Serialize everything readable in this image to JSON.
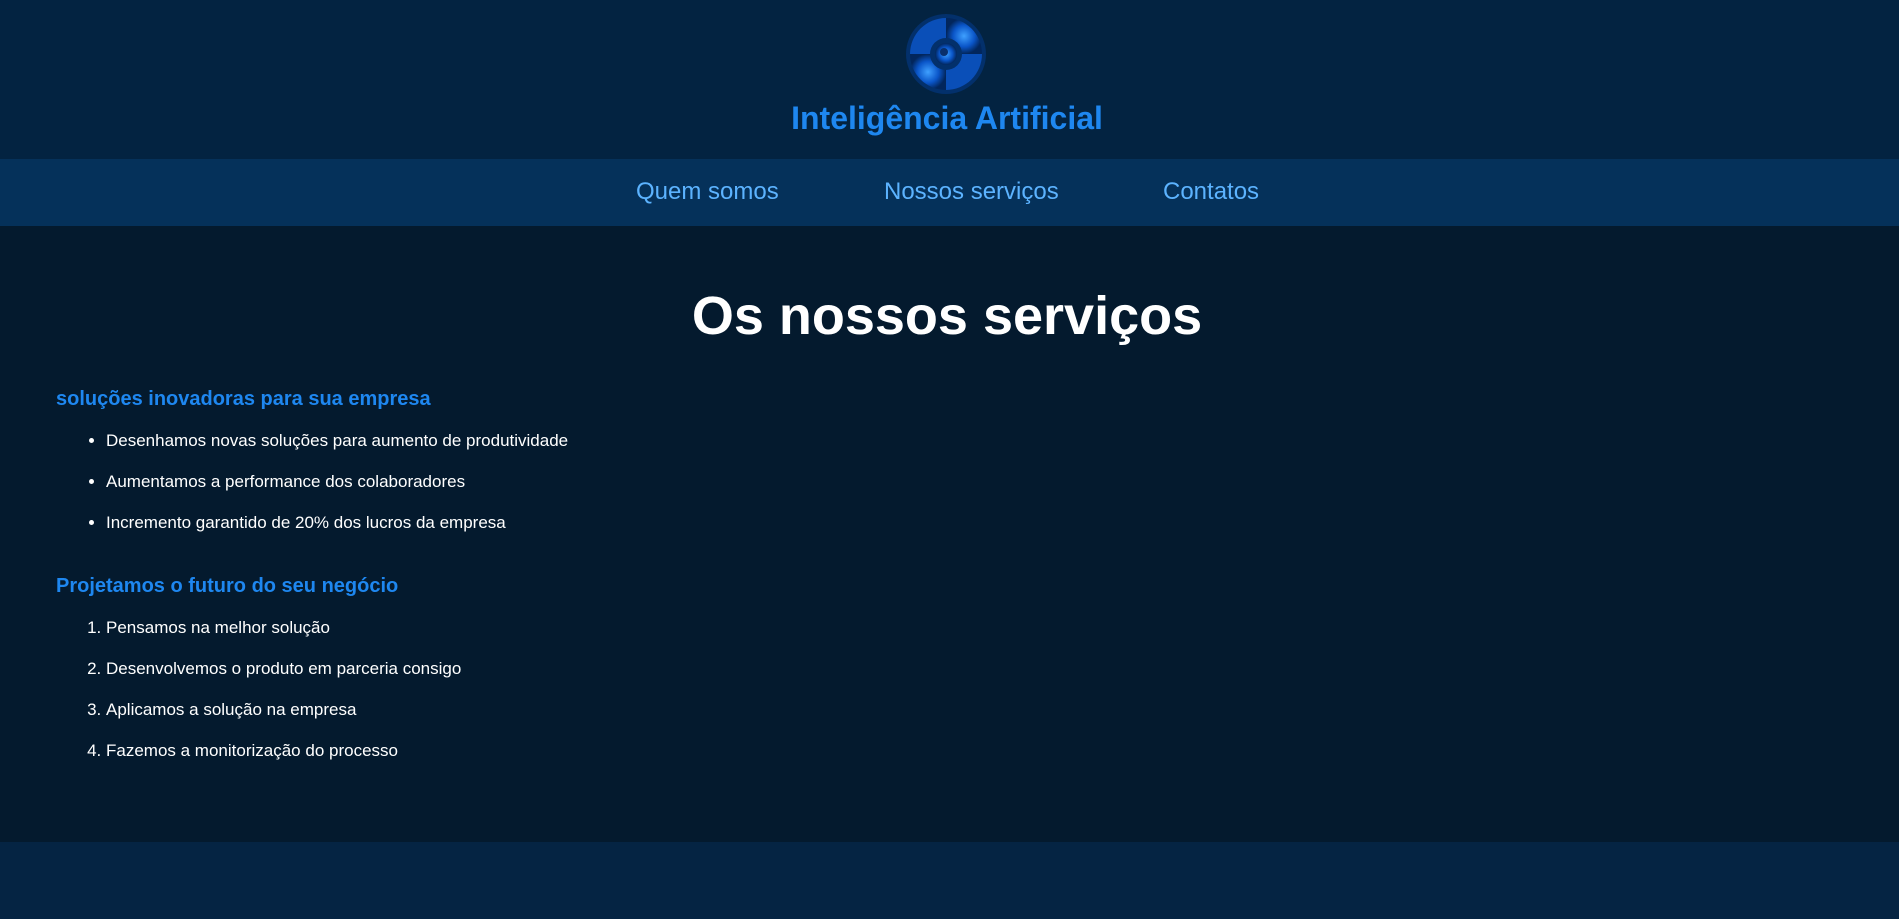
{
  "header": {
    "title": "Inteligência Artificial",
    "logo_icon": "spiral-logo-icon"
  },
  "nav": {
    "items": [
      {
        "label": "Quem somos"
      },
      {
        "label": "Nossos serviços"
      },
      {
        "label": "Contatos"
      }
    ]
  },
  "main": {
    "title": "Os nossos serviços",
    "section1": {
      "heading": "soluções inovadoras para sua empresa",
      "items": [
        "Desenhamos novas soluções para aumento de produtividade",
        "Aumentamos a performance dos colaboradores",
        "Incremento garantido de 20% dos lucros da empresa"
      ]
    },
    "section2": {
      "heading": "Projetamos o futuro do seu negócio",
      "items": [
        "Pensamos na melhor solução",
        "Desenvolvemos o produto em parceria consigo",
        "Aplicamos a solução na empresa",
        "Fazemos a monitorização do processo"
      ]
    }
  },
  "colors": {
    "header_bg": "#032341",
    "nav_bg": "#05315a",
    "main_bg": "#041a2e",
    "accent": "#1e87f0",
    "nav_link": "#5cb3ff"
  }
}
